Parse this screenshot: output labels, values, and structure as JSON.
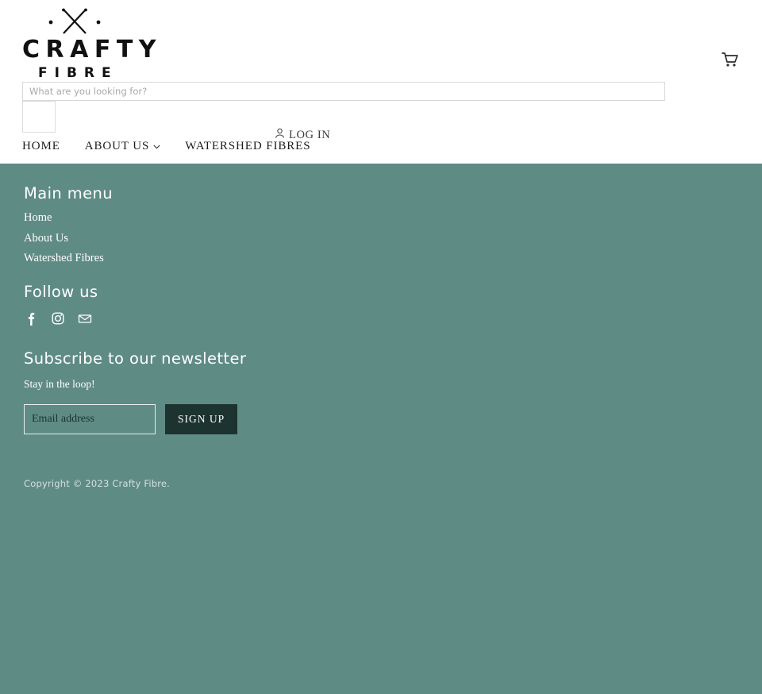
{
  "brand": {
    "logo_line1": "CRAFTY",
    "logo_line2": "FIBRE"
  },
  "header": {
    "cart_icon": "shopping-cart-icon",
    "search": {
      "placeholder": "What are you looking for?",
      "value": "",
      "submit_label": ""
    },
    "login": {
      "label": "LOG IN",
      "icon": "user-icon"
    },
    "nav": [
      {
        "label": "HOME",
        "has_dropdown": false
      },
      {
        "label": "ABOUT US",
        "has_dropdown": true
      },
      {
        "label": "WATERSHED FIBRES",
        "has_dropdown": false
      }
    ]
  },
  "footer": {
    "main_menu": {
      "heading": "Main menu",
      "links": [
        {
          "label": "Home"
        },
        {
          "label": "About Us"
        },
        {
          "label": "Watershed Fibres"
        }
      ]
    },
    "follow": {
      "heading": "Follow us",
      "socials": [
        {
          "name": "facebook-icon"
        },
        {
          "name": "instagram-icon"
        },
        {
          "name": "email-icon"
        }
      ]
    },
    "newsletter": {
      "heading": "Subscribe to our newsletter",
      "subtext": "Stay in the loop!",
      "email_placeholder": "Email address",
      "email_value": "",
      "signup_label": "SIGN UP"
    },
    "copyright": "Copyright © 2023 Crafty Fibre."
  },
  "colors": {
    "footer_bg": "#5f8b85",
    "button_dark": "#1d3330",
    "text_dark": "#1c1c1c",
    "white": "#ffffff"
  }
}
